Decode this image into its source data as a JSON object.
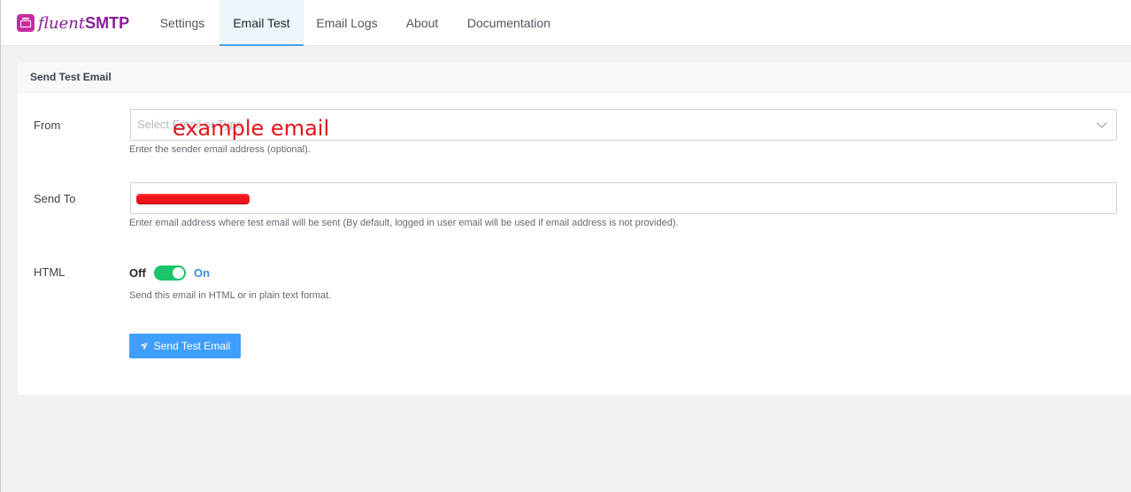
{
  "brand": {
    "part1": "fluent",
    "part2": "SMTP"
  },
  "tabs": [
    {
      "label": "Settings",
      "active": false
    },
    {
      "label": "Email Test",
      "active": true
    },
    {
      "label": "Email Logs",
      "active": false
    },
    {
      "label": "About",
      "active": false
    },
    {
      "label": "Documentation",
      "active": false
    }
  ],
  "card": {
    "title": "Send Test Email",
    "from": {
      "label": "From",
      "placeholder": "Select Email or Type",
      "annotation": "example email",
      "help": "Enter the sender email address (optional)."
    },
    "send_to": {
      "label": "Send To",
      "help": "Enter email address where test email will be sent (By default, logged in user email will be used if email address is not provided)."
    },
    "html": {
      "label": "HTML",
      "off_label": "Off",
      "on_label": "On",
      "enabled": true,
      "help": "Send this email in HTML or in plain text format."
    },
    "send_button": "Send Test Email"
  },
  "colors": {
    "accent": "#409eff",
    "toggle_on": "#1cc46b",
    "brand": "#8a1b9b",
    "annotation": "#e3141b"
  },
  "icons": {
    "logo": "fluentsmtp-logo-icon",
    "select": "chevron-down-icon",
    "button": "paper-plane-icon"
  }
}
